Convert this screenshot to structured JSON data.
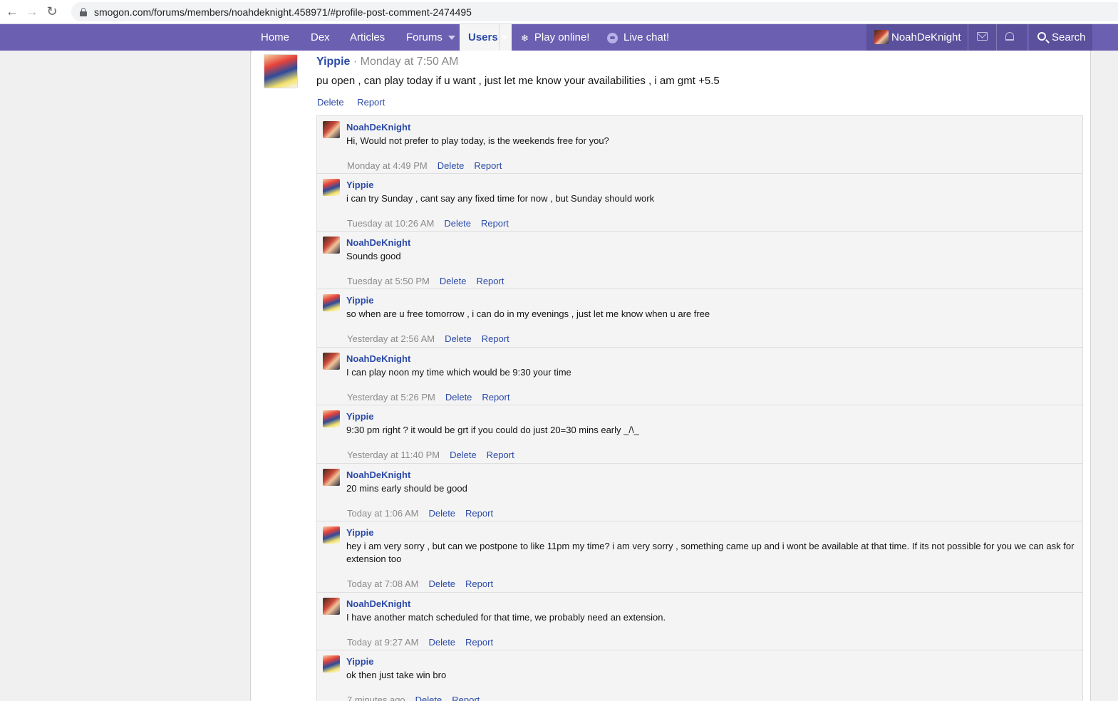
{
  "browser": {
    "url": "smogon.com/forums/members/noahdeknight.458971/#profile-post-comment-2474495"
  },
  "nav": {
    "home": "Home",
    "dex": "Dex",
    "articles": "Articles",
    "forums": "Forums",
    "users": "Users",
    "play": "Play online!",
    "chat": "Live chat!",
    "username": "NoahDeKnight",
    "search": "Search"
  },
  "post": {
    "author": "Yippie",
    "dot": " · ",
    "time": "Monday at 7:50 AM",
    "text": "pu open , can play today if u want , just let me know your availabilities , i am gmt +5.5",
    "delete": "Delete",
    "report": "Report"
  },
  "comments": [
    {
      "author": "NoahDeKnight",
      "text": "Hi, Would not prefer to play today, is the weekends free for you?",
      "time": "Monday at 4:49 PM",
      "delete": "Delete",
      "report": "Report"
    },
    {
      "author": "Yippie",
      "text": "i can try Sunday , cant say any fixed time for now , but Sunday should work",
      "time": "Tuesday at 10:26 AM",
      "delete": "Delete",
      "report": "Report"
    },
    {
      "author": "NoahDeKnight",
      "text": "Sounds good",
      "time": "Tuesday at 5:50 PM",
      "delete": "Delete",
      "report": "Report"
    },
    {
      "author": "Yippie",
      "text": "so when are u free tomorrow , i can do in my evenings , just let me know when u are free",
      "time": "Yesterday at 2:56 AM",
      "delete": "Delete",
      "report": "Report"
    },
    {
      "author": "NoahDeKnight",
      "text": "I can play noon my time which would be 9:30 your time",
      "time": "Yesterday at 5:26 PM",
      "delete": "Delete",
      "report": "Report"
    },
    {
      "author": "Yippie",
      "text": "9:30 pm right ? it would be grt if you could do just 20=30 mins early _/\\_",
      "time": "Yesterday at 11:40 PM",
      "delete": "Delete",
      "report": "Report"
    },
    {
      "author": "NoahDeKnight",
      "text": "20 mins early should be good",
      "time": "Today at 1:06 AM",
      "delete": "Delete",
      "report": "Report"
    },
    {
      "author": "Yippie",
      "text": "hey i am very sorry , but can we postpone to like 11pm my time? i am very sorry , something came up and i wont be available at that time. If its not possible for you we can ask for extension too",
      "time": "Today at 7:08 AM",
      "delete": "Delete",
      "report": "Report"
    },
    {
      "author": "NoahDeKnight",
      "text": "I have another match scheduled for that time, we probably need an extension.",
      "time": "Today at 9:27 AM",
      "delete": "Delete",
      "report": "Report"
    },
    {
      "author": "Yippie",
      "text": "ok then just take win bro",
      "time": "7 minutes ago",
      "delete": "Delete",
      "report": "Report"
    }
  ]
}
